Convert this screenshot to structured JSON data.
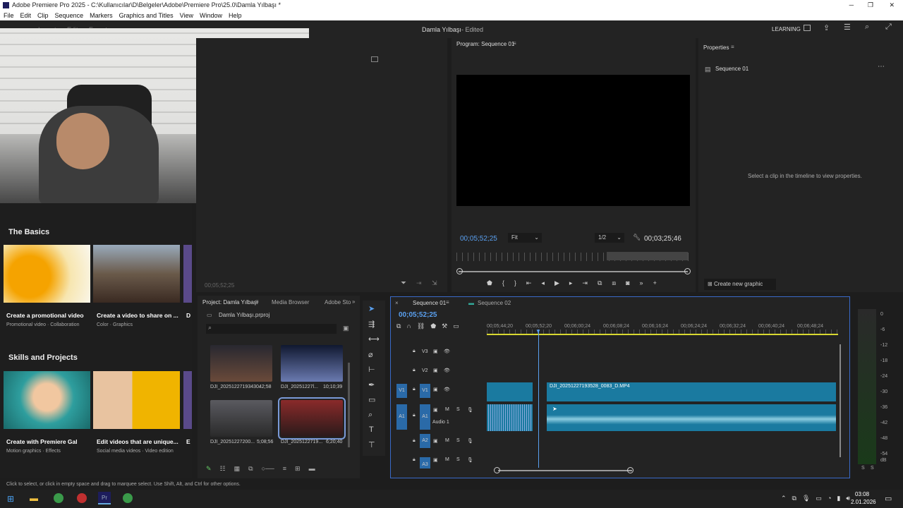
{
  "window": {
    "title": "Adobe Premiere Pro 2025 - C:\\Kullanıcılar\\D\\Belgeler\\Adobe\\Premiere Pro\\25.0\\Damla Yılbaşı *"
  },
  "menu": [
    "File",
    "Edit",
    "Clip",
    "Sequence",
    "Markers",
    "Graphics and Titles",
    "View",
    "Window",
    "Help"
  ],
  "header": {
    "import": "Import",
    "edit": "Edit",
    "export": "Export",
    "project_title": "Damla Yılbaşı",
    "status": "- Edited",
    "learning": "LEARNING"
  },
  "program": {
    "tab": "Program: Sequence 01",
    "timecode": "00;05;52;25",
    "fit": "Fit",
    "quality": "1/2",
    "duration": "00;03;25;46"
  },
  "source": {
    "timecode": "00;05;52;25"
  },
  "properties": {
    "tab": "Properties",
    "sequence": "Sequence 01",
    "hint": "Select a clip in the timeline to view properties.",
    "create_graphic": "Create new graphic"
  },
  "learn": {
    "basics": "The Basics",
    "cards1": [
      {
        "title": "Create a promotional video",
        "sub": "Promotional video · Collaboration"
      },
      {
        "title": "Create a video to share on ...",
        "sub": "Color · Graphics"
      },
      {
        "title": "D"
      }
    ],
    "skills": "Skills and Projects",
    "cards2": [
      {
        "title": "Create with Premiere Gal",
        "sub": "Motion graphics · Effects"
      },
      {
        "title": "Edit videos that are unique...",
        "sub": "Social media videos · Video edition"
      },
      {
        "title": "E"
      }
    ]
  },
  "project": {
    "tabs": [
      "Project: Damla Yılbaşı",
      "Media Browser",
      "Adobe Sto"
    ],
    "file": "Damla Yılbaşı.prproj",
    "items": [
      {
        "name": "DJI_20251227193430...",
        "dur": "42;58"
      },
      {
        "name": "DJI_20251227l...",
        "dur": "10;10;39"
      },
      {
        "name": "DJI_20251227200...",
        "dur": "5;08;56"
      },
      {
        "name": "DJI_2025122719...",
        "dur": "6;20;40"
      }
    ]
  },
  "timeline": {
    "tabs": [
      "Sequence 01",
      "Sequence 02"
    ],
    "timecode": "00;05;52;25",
    "ruler": [
      "00;05;44;20",
      "00;05;52;20",
      "00;06;00;24",
      "00;06;08;24",
      "00;06;16;24",
      "00;06;24;24",
      "00;06;32;24",
      "00;06;40;24",
      "00;06;48;24"
    ],
    "tracks": {
      "v3": "V3",
      "v2": "V2",
      "v1": "V1",
      "a1": "A1",
      "a2": "A2",
      "a3": "A3",
      "m": "M",
      "s": "S"
    },
    "audio_label": "Audio 1",
    "clip": "DJI_20251227193528_0083_D.MP4"
  },
  "meter": [
    "0",
    "-6",
    "-12",
    "-18",
    "-24",
    "-30",
    "-36",
    "-42",
    "-48",
    "-54",
    "dB"
  ],
  "status_hint": "Click to select, or click in empty space and drag to marquee select. Use Shift, Alt, and Ctrl for other options.",
  "taskbar": {
    "time": "03:08",
    "date": "2.01.2026"
  }
}
